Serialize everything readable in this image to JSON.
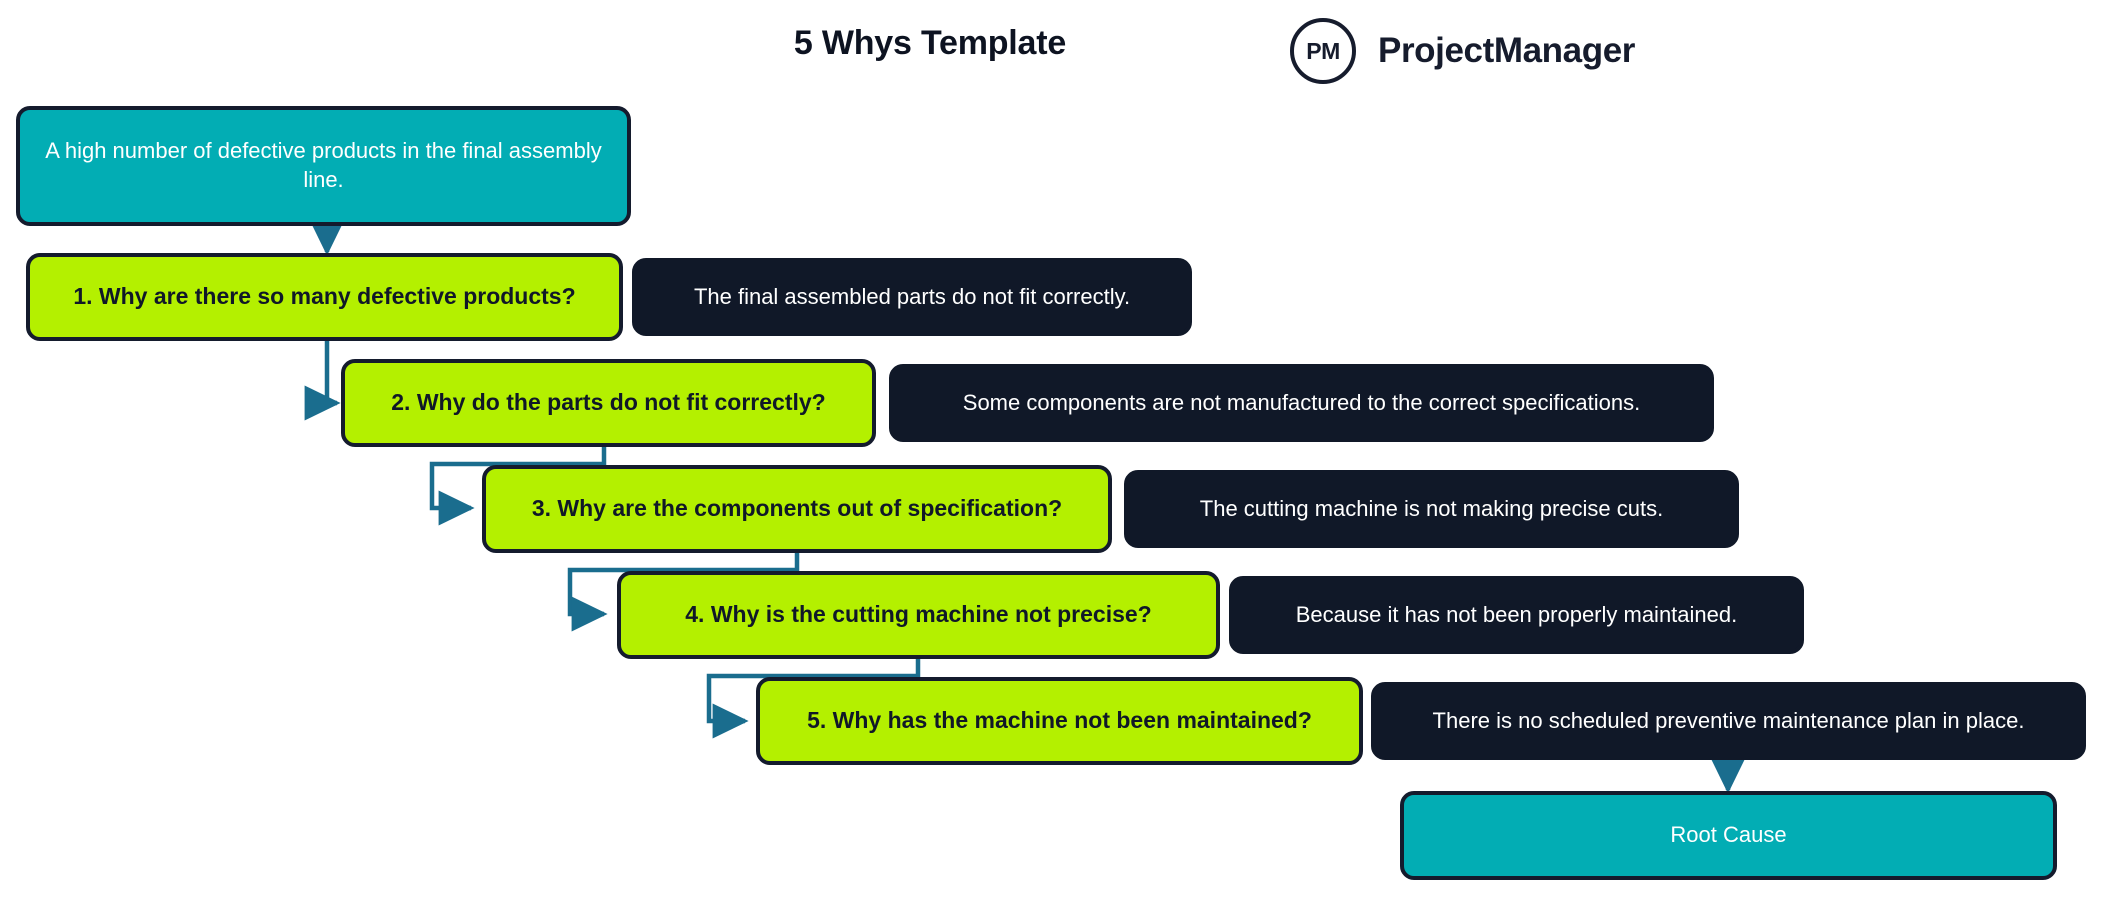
{
  "header": {
    "title": "5 Whys Template",
    "brand_mark": "PM",
    "brand_name": "ProjectManager"
  },
  "colors": {
    "teal": "#02adb4",
    "green": "#b4f000",
    "dark": "#101828",
    "connector": "#1a6d8e",
    "border": "#141b2d",
    "background": "#ffffff"
  },
  "diagram": {
    "type": "5-whys-flowchart",
    "problem_statement": "A high number of defective products in the final assembly line.",
    "root_cause_label": "Root Cause",
    "whys": [
      {
        "question": "1. Why are there so many defective products?",
        "answer": "The final assembled parts do not fit correctly."
      },
      {
        "question": "2. Why do the parts do not fit correctly?",
        "answer": "Some components are not manufactured to the correct specifications."
      },
      {
        "question": "3. Why are the components out of specification?",
        "answer": "The cutting machine is not making precise cuts."
      },
      {
        "question": "4. Why is the cutting machine not precise?",
        "answer": "Because it has not been properly maintained."
      },
      {
        "question": "5. Why has the machine not been maintained?",
        "answer": "There is no scheduled preventive maintenance plan in place."
      }
    ]
  }
}
